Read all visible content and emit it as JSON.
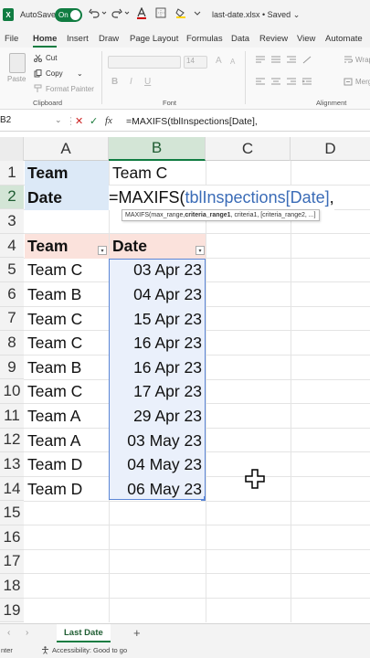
{
  "titlebar": {
    "logo": "X",
    "autosave_label": "AutoSave",
    "autosave_state": "On",
    "doc_title": "last-date.xlsx • Saved ⌄"
  },
  "menu": [
    "File",
    "Home",
    "Insert",
    "Draw",
    "Page Layout",
    "Formulas",
    "Data",
    "Review",
    "View",
    "Automate"
  ],
  "ribbon": {
    "paste": "Paste",
    "cut": "Cut",
    "copy": "Copy",
    "format_painter": "Format Painter",
    "font_size": "14",
    "clipboard_label": "Clipboard",
    "font_label": "Font",
    "alignment_label": "Alignment",
    "wrap": "Wrap",
    "merge": "Merg"
  },
  "formula_bar": {
    "name_box": "B2",
    "fx": "fx",
    "formula": "=MAXIFS(tblInspections[Date],"
  },
  "columns": [
    "A",
    "B",
    "C",
    "D"
  ],
  "rows": [
    "1",
    "2",
    "3",
    "4",
    "5",
    "6",
    "7",
    "8",
    "9",
    "10",
    "11",
    "12",
    "13",
    "14",
    "15",
    "16",
    "17",
    "18",
    "19"
  ],
  "cells": {
    "A1": "Team",
    "B1": "Team C",
    "A2": "Date",
    "B2_prefix": "=MAXIFS(",
    "B2_ref": "tblInspections[Date]",
    "B2_suffix": ","
  },
  "tooltip": {
    "fn": "MAXIFS(max_range, ",
    "bold_arg": "criteria_range1",
    "rest": ", criteria1, [criteria_range2, ...]"
  },
  "table": {
    "headers": [
      "Team",
      "Date"
    ],
    "rows": [
      [
        "Team C",
        "03 Apr 23"
      ],
      [
        "Team B",
        "04 Apr 23"
      ],
      [
        "Team C",
        "15 Apr 23"
      ],
      [
        "Team C",
        "16 Apr 23"
      ],
      [
        "Team B",
        "16 Apr 23"
      ],
      [
        "Team C",
        "17 Apr 23"
      ],
      [
        "Team A",
        "29 Apr 23"
      ],
      [
        "Team A",
        "03 May 23"
      ],
      [
        "Team D",
        "04 May 23"
      ],
      [
        "Team D",
        "06 May 23"
      ]
    ]
  },
  "sheets": {
    "active": "Last Date",
    "add": "+"
  },
  "status": {
    "left": "nter",
    "accessibility": "Accessibility: Good to go"
  },
  "colors": {
    "accent": "#107c41",
    "header_fill_blue": "#dce9f7",
    "header_fill_pink": "#fbe2dc",
    "ref_blue": "#3b6cb7"
  }
}
